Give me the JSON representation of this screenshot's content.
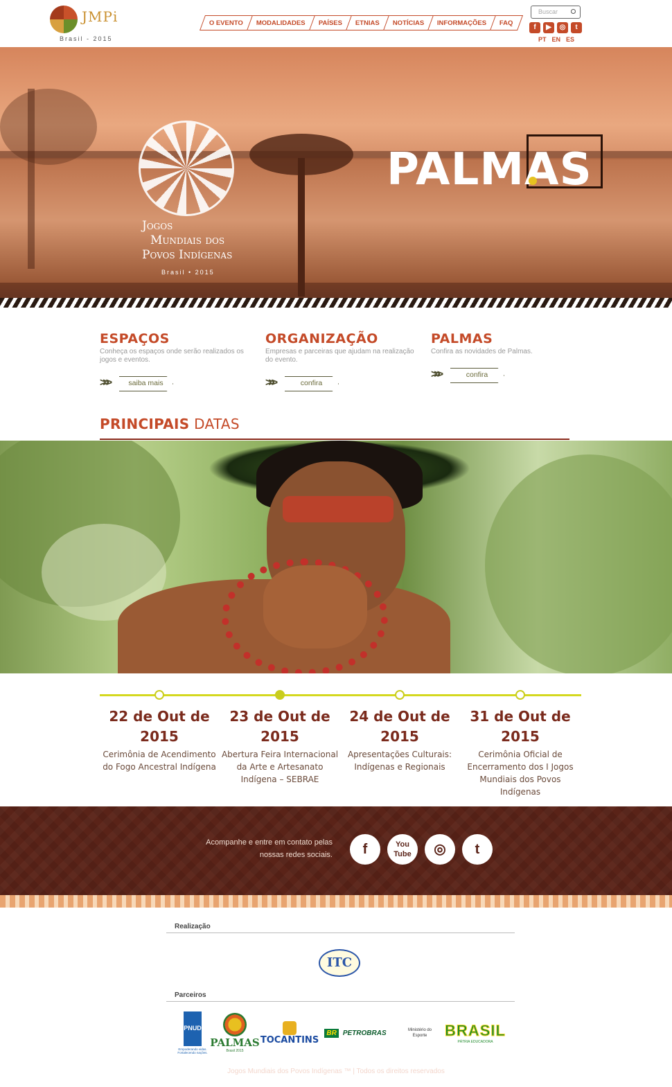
{
  "header": {
    "logo_text": "JMPi",
    "logo_sub": "Brasil - 2015",
    "nav": [
      "O EVENTO",
      "MODALIDADES",
      "PAÍSES",
      "ETNIAS",
      "NOTÍCIAS",
      "INFORMAÇÕES",
      "FAQ"
    ],
    "search_placeholder": "Buscar",
    "social_icons": [
      "facebook-icon",
      "youtube-icon",
      "instagram-icon",
      "twitter-icon"
    ],
    "langs": [
      "PT",
      "EN",
      "ES"
    ]
  },
  "hero": {
    "logo_lines": [
      "Jogos",
      "Mundiais dos",
      "Povos Indígenas"
    ],
    "logo_sub": "Brasil • 2015",
    "city": "PALMAS"
  },
  "features": [
    {
      "title": "ESPAÇOS",
      "desc": "Conheça os espaços onde serão realizados os jogos e eventos.",
      "button": "saiba mais"
    },
    {
      "title": "ORGANIZAÇÃO",
      "desc": "Empresas e parceiras que ajudam na realização do evento.",
      "button": "confira"
    },
    {
      "title": "PALMAS",
      "desc": "Confira as novidades de Palmas.",
      "button": "confira"
    }
  ],
  "section_title": {
    "bold": "PRINCIPAIS",
    "light": " DATAS"
  },
  "timeline": [
    {
      "date": "22 de Out de 2015",
      "desc": "Cerimônia de Acendimento do Fogo Ancestral Indígena"
    },
    {
      "date": "23 de Out de 2015",
      "desc": "Abertura Feira Internacional da Arte e Artesanato Indígena – SEBRAE"
    },
    {
      "date": "24 de Out de 2015",
      "desc": "Apresentações Culturais: Indígenas e Regionais"
    },
    {
      "date": "31 de Out de 2015",
      "desc": "Cerimônia Oficial de Encerramento dos I Jogos Mundiais dos Povos Indígenas"
    }
  ],
  "social_band": {
    "text": "Acompanhe e entre em contato pelas nossas redes sociais.",
    "icons": [
      "facebook-icon",
      "youtube-icon",
      "instagram-icon",
      "twitter-icon"
    ]
  },
  "footer": {
    "realizacao": "Realização",
    "parceiros": "Parceiros",
    "itc": "ITC",
    "pnud": "PNUD",
    "pnud_cap": "Empoderando vidas. Fortalecendo nações.",
    "palmas": "PALMAS",
    "palmas_year": "Brasil 2015",
    "tocantins": "TOCANTINS",
    "petrobras_br": "BR",
    "petrobras": "PETROBRAS",
    "ministerio": "Ministério do Esporte",
    "brasil": "BRASIL",
    "brasil_cap": "PÁTRIA EDUCADORA",
    "copyright": "Jogos Mundiais dos Povos Indígenas ™ | Todos os direitos reservados"
  }
}
